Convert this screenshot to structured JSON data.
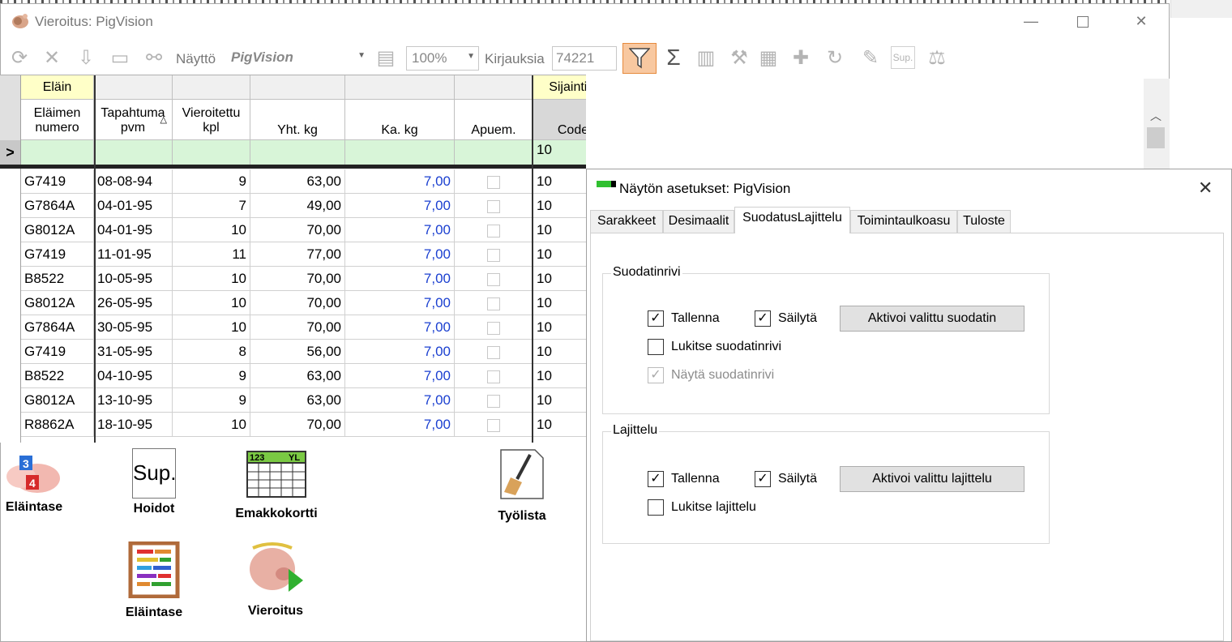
{
  "window": {
    "title": "Vieroitus: PigVision"
  },
  "toolbar": {
    "display_label": "Näyttö",
    "display_value": "PigVision",
    "zoom_value": "100%",
    "records_label": "Kirjauksia",
    "records_value": "74221",
    "sum_symbol": "Σ",
    "sup_label": "Sup."
  },
  "grid": {
    "group_headers": {
      "animal": "Eläin",
      "location": "Sijaintiin"
    },
    "columns": [
      {
        "label": "Eläimen numero"
      },
      {
        "label": "Tapahtuma pvm"
      },
      {
        "label": "Vieroitettu kpl"
      },
      {
        "label": "Yht. kg"
      },
      {
        "label": "Ka. kg"
      },
      {
        "label": "Apuem."
      },
      {
        "label": "Code"
      }
    ],
    "filter_row": {
      "indicator": ">",
      "code": "10"
    },
    "rows": [
      {
        "animal": "G7419",
        "date": "08-08-94",
        "count": "9",
        "total": "63,00",
        "avg": "7,00",
        "code": "10"
      },
      {
        "animal": "G7864A",
        "date": "04-01-95",
        "count": "7",
        "total": "49,00",
        "avg": "7,00",
        "code": "10"
      },
      {
        "animal": "G8012A",
        "date": "04-01-95",
        "count": "10",
        "total": "70,00",
        "avg": "7,00",
        "code": "10"
      },
      {
        "animal": "G7419",
        "date": "11-01-95",
        "count": "11",
        "total": "77,00",
        "avg": "7,00",
        "code": "10"
      },
      {
        "animal": "B8522",
        "date": "10-05-95",
        "count": "10",
        "total": "70,00",
        "avg": "7,00",
        "code": "10"
      },
      {
        "animal": "G8012A",
        "date": "26-05-95",
        "count": "10",
        "total": "70,00",
        "avg": "7,00",
        "code": "10"
      },
      {
        "animal": "G7864A",
        "date": "30-05-95",
        "count": "10",
        "total": "70,00",
        "avg": "7,00",
        "code": "10"
      },
      {
        "animal": "G7419",
        "date": "31-05-95",
        "count": "8",
        "total": "56,00",
        "avg": "7,00",
        "code": "10"
      },
      {
        "animal": "B8522",
        "date": "04-10-95",
        "count": "9",
        "total": "63,00",
        "avg": "7,00",
        "code": "10"
      },
      {
        "animal": "G8012A",
        "date": "13-10-95",
        "count": "9",
        "total": "63,00",
        "avg": "7,00",
        "code": "10"
      },
      {
        "animal": "R8862A",
        "date": "18-10-95",
        "count": "10",
        "total": "70,00",
        "avg": "7,00",
        "code": "10"
      }
    ]
  },
  "shortcuts": {
    "elaintase_1": "Eläintase",
    "hoidot": "Hoidot",
    "sup_icon_text": "Sup.",
    "emakkokortti": "Emakkokortti",
    "emakkokortti_icon_num": "123",
    "emakkokortti_icon_yl": "YL",
    "tyolista": "Työlista",
    "elaintase_2": "Eläintase",
    "vieroitus": "Vieroitus"
  },
  "dialog": {
    "title": "Näytön asetukset: PigVision",
    "tabs": [
      "Sarakkeet",
      "Desimaalit",
      "SuodatusLajittelu",
      "Toimintaulkoasu",
      "Tuloste"
    ],
    "active_tab": 2,
    "filter_group": {
      "legend": "Suodatinrivi",
      "save": "Tallenna",
      "keep": "Säilytä",
      "activate_button": "Aktivoi valittu suodatin",
      "lock": "Lukitse suodatinrivi",
      "show": "Näytä suodatinrivi"
    },
    "sort_group": {
      "legend": "Lajittelu",
      "save": "Tallenna",
      "keep": "Säilytä",
      "activate_button": "Aktivoi valittu lajittelu",
      "lock": "Lukitse lajittelu"
    },
    "checkbox_states": {
      "filter_save": true,
      "filter_keep": true,
      "filter_lock": false,
      "filter_show": true,
      "sort_save": true,
      "sort_keep": true,
      "sort_lock": false
    },
    "accent_color": "#30c030"
  }
}
